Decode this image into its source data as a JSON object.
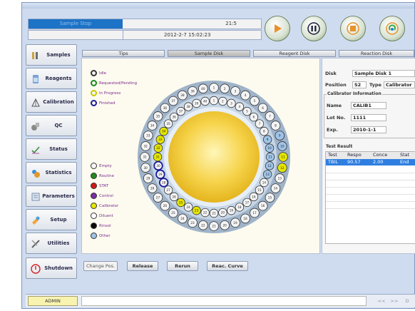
{
  "status": {
    "mode": "Sample Stop",
    "counter": "21:5",
    "datetime": "2012-2-7 15:02:23"
  },
  "controls": [
    {
      "name": "play-button",
      "icon": "play-icon",
      "color": "#e8912b"
    },
    {
      "name": "pause-button",
      "icon": "pause-icon",
      "color": "#1b1b3a"
    },
    {
      "name": "stop-button",
      "icon": "stop-icon",
      "color": "#e8912b"
    },
    {
      "name": "refresh-button",
      "icon": "refresh-icon",
      "color": "#e8912b"
    }
  ],
  "sidebar": {
    "items": [
      {
        "label": "Samples",
        "icon": "samples-icon"
      },
      {
        "label": "Reagents",
        "icon": "reagents-icon"
      },
      {
        "label": "Calibration",
        "icon": "calibration-icon"
      },
      {
        "label": "QC",
        "icon": "qc-icon"
      },
      {
        "label": "Status",
        "icon": "status-icon"
      },
      {
        "label": "Statistics",
        "icon": "statistics-icon"
      },
      {
        "label": "Parameters",
        "icon": "parameters-icon"
      },
      {
        "label": "Setup",
        "icon": "setup-icon"
      },
      {
        "label": "Utilities",
        "icon": "utilities-icon"
      },
      {
        "label": "Shutdown",
        "icon": "shutdown-icon"
      }
    ]
  },
  "tabs": [
    {
      "label": "Tips",
      "active": false
    },
    {
      "label": "Sample Disk",
      "active": true
    },
    {
      "label": "Reagent Disk",
      "active": false
    },
    {
      "label": "Reaction Disk",
      "active": false
    }
  ],
  "state_legend": [
    {
      "label": "Idle",
      "color": "#f4f4f4",
      "ring": "#333333"
    },
    {
      "label": "Requested/Pending",
      "color": "#f4f4f4",
      "ring": "#1a8a1a"
    },
    {
      "label": "In Progress",
      "color": "#f4f4f4",
      "ring": "#c8c800"
    },
    {
      "label": "Finished",
      "color": "#f4f4f4",
      "ring": "#1a1a9a"
    }
  ],
  "type_legend": [
    {
      "label": "Empty",
      "color": "#f4f4f4"
    },
    {
      "label": "Routine",
      "color": "#1e8c1e"
    },
    {
      "label": "STAT",
      "color": "#d01a1a"
    },
    {
      "label": "Control",
      "color": "#7a2ca6"
    },
    {
      "label": "Calibrator",
      "color": "#e6e600"
    },
    {
      "label": "Diluent",
      "color": "#ffffff"
    },
    {
      "label": "Rinsol",
      "color": "#0a0a0a"
    },
    {
      "label": "Other",
      "color": "#9fc4e8"
    }
  ],
  "disk": {
    "outer_positions": 40,
    "inner_positions": 40,
    "highlight_colors": {
      "calibrator": "#e6e600",
      "finished": "#1a1a9a",
      "other": "#9fc4e8"
    }
  },
  "info": {
    "disk_label": "Disk",
    "disk_value": "Sample Disk 1",
    "position_label": "Position",
    "position_value": "S2",
    "type_label": "Type",
    "type_value": "Calibrator",
    "calibrator_group": "Calibrator Information",
    "name_label": "Name",
    "name_value": "CALIB1",
    "lot_label": "Lot No.",
    "lot_value": "1111",
    "exp_label": "Exp.",
    "exp_value": "2010-1-1",
    "result_group": "Test Result",
    "result_columns": [
      "Test",
      "Respo",
      "Conce",
      "Stat"
    ],
    "result_rows": [
      [
        "TBIL",
        "90.57",
        "2.00",
        "End"
      ]
    ]
  },
  "actions": {
    "change_pos": "Change Pos.",
    "release": "Release",
    "rerun": "Rerun",
    "reac_curve": "Reac. Curve"
  },
  "footer": {
    "user": "ADMIN",
    "nav_prev": "<<",
    "nav_next": ">>",
    "nav_end": "D"
  }
}
